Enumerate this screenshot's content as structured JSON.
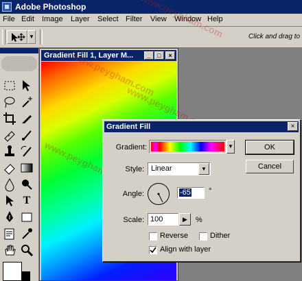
{
  "app": {
    "title": "Adobe Photoshop"
  },
  "menu": [
    "File",
    "Edit",
    "Image",
    "Layer",
    "Select",
    "Filter",
    "View",
    "Window",
    "Help"
  ],
  "options_bar": {
    "hint": "Click and drag to m"
  },
  "document": {
    "title": "Gradient Fill 1, Layer M..."
  },
  "dialog": {
    "title": "Gradient Fill",
    "ok_label": "OK",
    "cancel_label": "Cancel",
    "gradient_label": "Gradient:",
    "style_label": "Style:",
    "style_value": "Linear",
    "angle_label": "Angle:",
    "angle_value": "-65",
    "angle_unit": "°",
    "scale_label": "Scale:",
    "scale_value": "100",
    "scale_unit": "%",
    "reverse_label": "Reverse",
    "reverse_checked": false,
    "dither_label": "Dither",
    "dither_checked": false,
    "align_label": "Align with layer",
    "align_checked": true
  },
  "watermark": "www.peygham.com",
  "colors": {
    "titlebar": "#0a246a",
    "chrome": "#d4d0c8",
    "workspace": "#808080"
  }
}
